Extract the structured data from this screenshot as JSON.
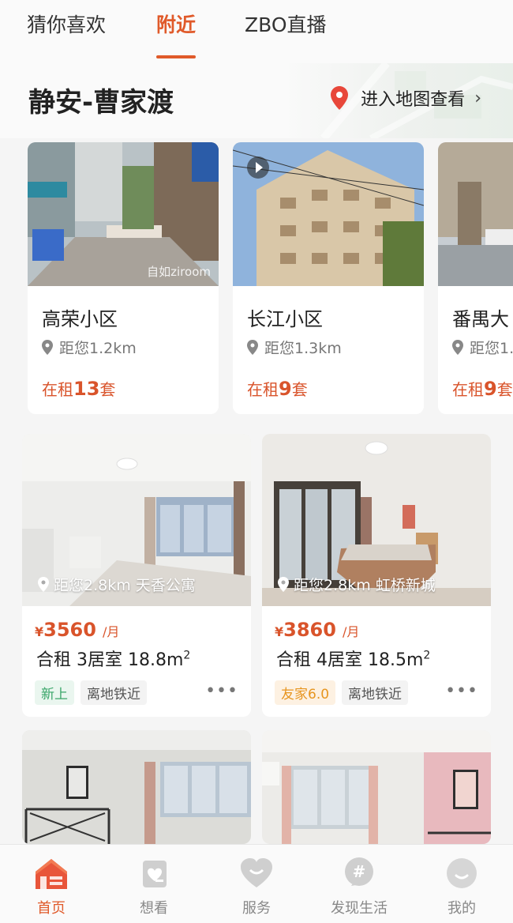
{
  "top_tabs": [
    {
      "label": "猜你喜欢",
      "active": false
    },
    {
      "label": "附近",
      "active": true
    },
    {
      "label": "ZBO直播",
      "active": false
    }
  ],
  "area": {
    "title": "静安-曹家渡",
    "map_link": "进入地图查看"
  },
  "communities": [
    {
      "name": "高荣小区",
      "distance": "距您1.2km",
      "rent_prefix": "在租",
      "rent_count": "13",
      "rent_suffix": "套",
      "watermark": "自如ziroom"
    },
    {
      "name": "长江小区",
      "distance": "距您1.3km",
      "rent_prefix": "在租",
      "rent_count": "9",
      "rent_suffix": "套"
    },
    {
      "name": "番禺大",
      "distance": "距您1.",
      "rent_prefix": "在租",
      "rent_count": "9",
      "rent_suffix": "套"
    }
  ],
  "listings": [
    {
      "distance_tag": "距您2.8km 天香公寓",
      "currency": "¥",
      "price": "3560",
      "unit": "/月",
      "title": "合租 3居室 18.8m",
      "sup": "2",
      "tags": [
        {
          "text": "新上",
          "style": "green"
        },
        {
          "text": "离地铁近",
          "style": "gray"
        }
      ],
      "more": "•••"
    },
    {
      "distance_tag": "距您2.8km 虹桥新城",
      "currency": "¥",
      "price": "3860",
      "unit": "/月",
      "title": "合租 4居室 18.5m",
      "sup": "2",
      "tags": [
        {
          "text": "友家6.0",
          "style": "orange"
        },
        {
          "text": "离地铁近",
          "style": "gray"
        }
      ],
      "more": "•••"
    }
  ],
  "bottom_nav": [
    {
      "label": "首页",
      "icon": "home-icon",
      "active": true
    },
    {
      "label": "想看",
      "icon": "wishlist-icon",
      "active": false
    },
    {
      "label": "服务",
      "icon": "heart-service-icon",
      "active": false
    },
    {
      "label": "发现生活",
      "icon": "hashtag-icon",
      "active": false
    },
    {
      "label": "我的",
      "icon": "profile-icon",
      "active": false
    }
  ],
  "colors": {
    "accent": "#e05a2a",
    "price": "#d9542b"
  }
}
